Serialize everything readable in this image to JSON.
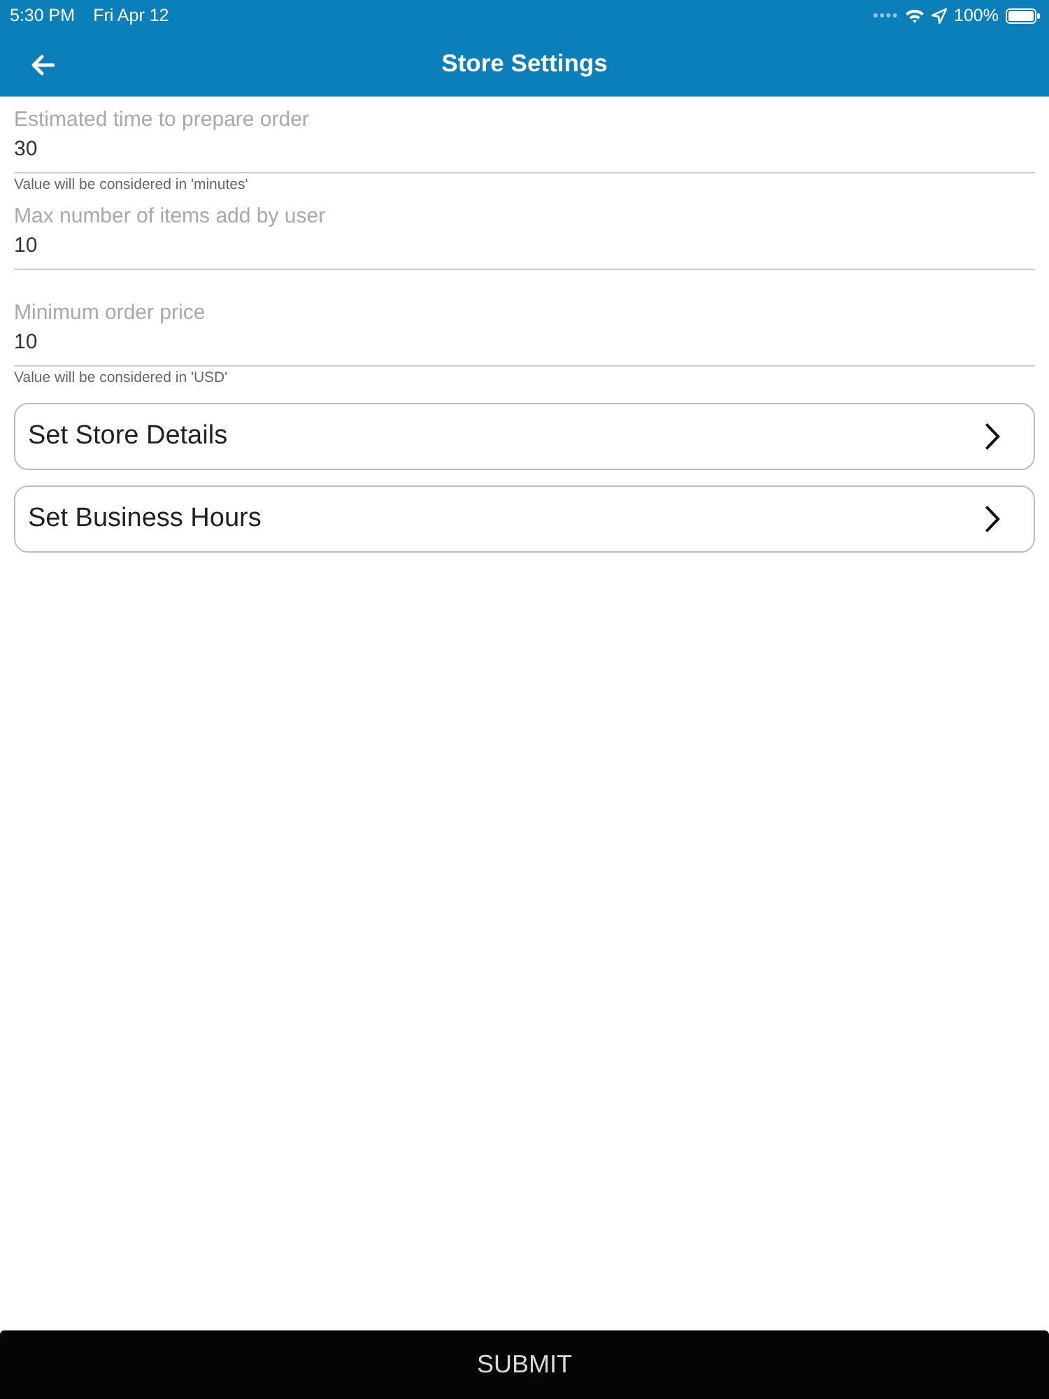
{
  "status_bar": {
    "time": "5:30 PM",
    "date": "Fri Apr 12",
    "battery": "100%"
  },
  "header": {
    "title": "Store Settings"
  },
  "fields": [
    {
      "label": "Estimated time to prepare order",
      "value": "30",
      "helper": "Value will be considered in 'minutes'"
    },
    {
      "label": "Max number of items add by user",
      "value": "10"
    },
    {
      "label": "Minimum order price",
      "value": "10",
      "helper": "Value will be considered in 'USD'"
    }
  ],
  "links": [
    {
      "label": "Set Store Details"
    },
    {
      "label": "Set Business Hours"
    }
  ],
  "submit": {
    "label": "SUBMIT"
  }
}
